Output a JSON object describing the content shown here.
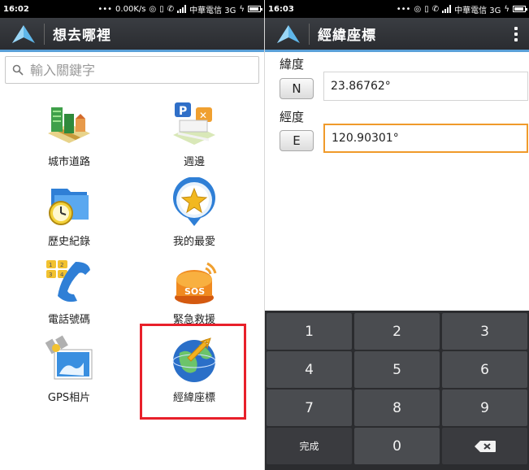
{
  "left": {
    "status": {
      "time": "16:02",
      "speed": "0.00K/s",
      "carrier": "中華電信 3G"
    },
    "appbar": {
      "title": "想去哪裡"
    },
    "search": {
      "placeholder": "輸入關鍵字"
    },
    "menu": [
      {
        "label": "城市道路",
        "icon": "city-roads-icon"
      },
      {
        "label": "週邊",
        "icon": "nearby-icon"
      },
      {
        "label": "歷史紀錄",
        "icon": "history-icon"
      },
      {
        "label": "我的最愛",
        "icon": "favorites-icon"
      },
      {
        "label": "電話號碼",
        "icon": "phone-icon"
      },
      {
        "label": "緊急救援",
        "icon": "sos-icon"
      },
      {
        "label": "GPS相片",
        "icon": "gps-photo-icon"
      },
      {
        "label": "經緯座標",
        "icon": "coordinates-icon"
      }
    ],
    "highlighted_item": "經緯座標",
    "highlight_color": "#e8202a"
  },
  "right": {
    "status": {
      "time": "16:03",
      "carrier": "中華電信 3G"
    },
    "appbar": {
      "title": "經緯座標"
    },
    "latitude": {
      "label": "緯度",
      "direction": "N",
      "value": "23.86762°"
    },
    "longitude": {
      "label": "經度",
      "direction": "E",
      "value": "120.90301°"
    },
    "keypad": {
      "keys": [
        "1",
        "2",
        "3",
        "4",
        "5",
        "6",
        "7",
        "8",
        "9",
        "完成",
        "0",
        "backspace"
      ]
    },
    "active_field_color": "#f09a2a"
  },
  "colors": {
    "appbar_accent": "#5aa0d8",
    "keypad_bg": "#2b2c2f"
  }
}
